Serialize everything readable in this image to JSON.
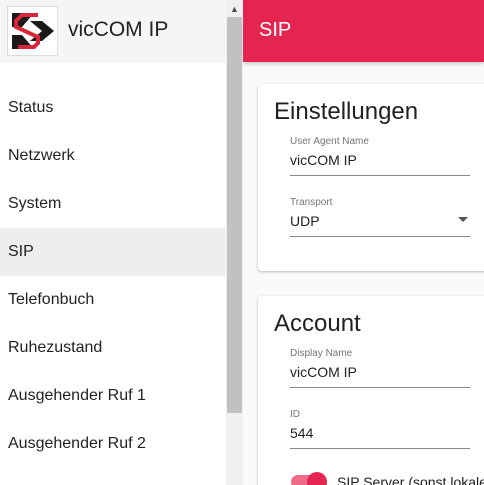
{
  "brand": {
    "title": "vicCOM IP"
  },
  "nav": {
    "items": [
      {
        "label": "Status"
      },
      {
        "label": "Netzwerk"
      },
      {
        "label": "System"
      },
      {
        "label": "SIP"
      },
      {
        "label": "Telefonbuch"
      },
      {
        "label": "Ruhezustand"
      },
      {
        "label": "Ausgehender Ruf 1"
      },
      {
        "label": "Ausgehender Ruf 2"
      }
    ],
    "active": "SIP"
  },
  "appbar": {
    "title": "SIP",
    "color": "#e4254f"
  },
  "settings": {
    "title": "Einstellungen",
    "user_agent_label": "User Agent Name",
    "user_agent_value": "vicCOM IP",
    "transport_label": "Transport",
    "transport_value": "UDP"
  },
  "account": {
    "title": "Account",
    "display_name_label": "Display Name",
    "display_name_value": "vicCOM IP",
    "id_label": "ID",
    "id_value": "544",
    "toggle_label": "SIP Server (sonst lokale",
    "toggle_on": true
  },
  "icons": {
    "logo": "viccom-logo-icon",
    "dropdown": "chevron-down-icon",
    "scroll_up": "scroll-up-arrow-icon"
  }
}
